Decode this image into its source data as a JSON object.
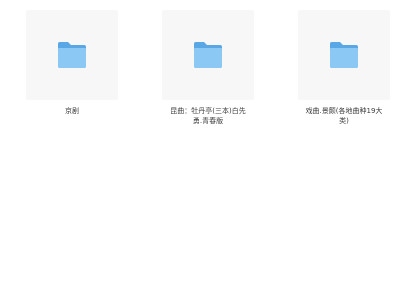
{
  "files": [
    {
      "name": "京剧",
      "icon": "folder-icon"
    },
    {
      "name": "昆曲：牡丹亭(三本)白先勇.青春版",
      "icon": "folder-icon"
    },
    {
      "name": "戏曲.景颇(各地曲种19大类)",
      "icon": "folder-icon"
    }
  ],
  "colors": {
    "tile_bg": "#f7f7f7",
    "folder_back": "#5aa7e6",
    "folder_front": "#8cc8f4"
  }
}
